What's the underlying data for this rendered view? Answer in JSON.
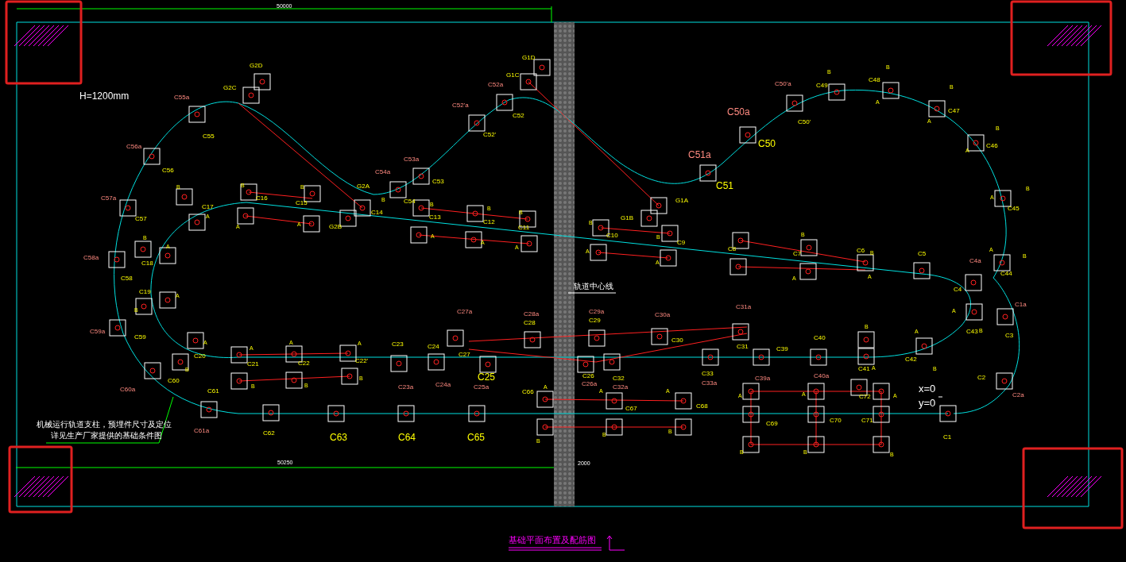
{
  "labels": [
    {
      "text": "50000",
      "kind": "dimension"
    },
    {
      "text": "H=1200mm",
      "kind": "height"
    },
    {
      "text": "G2D",
      "kind": "column"
    },
    {
      "text": "G2C",
      "kind": "column"
    },
    {
      "text": "C55a",
      "kind": "marker"
    },
    {
      "text": "C55",
      "kind": "column"
    },
    {
      "text": "C56a",
      "kind": "marker"
    },
    {
      "text": "C56",
      "kind": "column"
    },
    {
      "text": "C57a",
      "kind": "marker"
    },
    {
      "text": "C57",
      "kind": "column"
    },
    {
      "text": "C58a",
      "kind": "marker"
    },
    {
      "text": "C58",
      "kind": "column"
    },
    {
      "text": "B",
      "kind": "side"
    },
    {
      "text": "C17",
      "kind": "column"
    },
    {
      "text": "A",
      "kind": "side"
    },
    {
      "text": "B",
      "kind": "side"
    },
    {
      "text": "A",
      "kind": "side"
    },
    {
      "text": "C18",
      "kind": "column"
    },
    {
      "text": "B",
      "kind": "side"
    },
    {
      "text": "C16",
      "kind": "column"
    },
    {
      "text": "B",
      "kind": "side"
    },
    {
      "text": "C15",
      "kind": "column"
    },
    {
      "text": "A",
      "kind": "side"
    },
    {
      "text": "A",
      "kind": "side"
    },
    {
      "text": "G2A",
      "kind": "column"
    },
    {
      "text": "G2B",
      "kind": "column"
    },
    {
      "text": "C14",
      "kind": "column"
    },
    {
      "text": "C54a",
      "kind": "marker"
    },
    {
      "text": "B",
      "kind": "side"
    },
    {
      "text": "C53a",
      "kind": "marker"
    },
    {
      "text": "C54",
      "kind": "column"
    },
    {
      "text": "C53",
      "kind": "column"
    },
    {
      "text": "C52'a",
      "kind": "marker"
    },
    {
      "text": "C52'",
      "kind": "column"
    },
    {
      "text": "C52a",
      "kind": "marker"
    },
    {
      "text": "C52",
      "kind": "column"
    },
    {
      "text": "G1C",
      "kind": "column"
    },
    {
      "text": "G1D",
      "kind": "column"
    },
    {
      "text": "B",
      "kind": "side"
    },
    {
      "text": "C13",
      "kind": "column"
    },
    {
      "text": "A",
      "kind": "side"
    },
    {
      "text": "B",
      "kind": "side"
    },
    {
      "text": "C12",
      "kind": "column"
    },
    {
      "text": "A",
      "kind": "side"
    },
    {
      "text": "B",
      "kind": "side"
    },
    {
      "text": "C11",
      "kind": "column"
    },
    {
      "text": "A",
      "kind": "side"
    },
    {
      "text": "C51a",
      "kind": "marker_large"
    },
    {
      "text": "C51",
      "kind": "column_large"
    },
    {
      "text": "C50a",
      "kind": "marker_large"
    },
    {
      "text": "C50",
      "kind": "column_large"
    },
    {
      "text": "C50'a",
      "kind": "marker"
    },
    {
      "text": "C50'",
      "kind": "column"
    },
    {
      "text": "G1A",
      "kind": "column"
    },
    {
      "text": "G1B",
      "kind": "column"
    },
    {
      "text": "B",
      "kind": "side"
    },
    {
      "text": "C10",
      "kind": "column"
    },
    {
      "text": "A",
      "kind": "side"
    },
    {
      "text": "B",
      "kind": "side"
    },
    {
      "text": "C9",
      "kind": "column"
    },
    {
      "text": "A",
      "kind": "side"
    },
    {
      "text": "C8",
      "kind": "column"
    },
    {
      "text": "B",
      "kind": "side"
    },
    {
      "text": "C49",
      "kind": "column"
    },
    {
      "text": "B",
      "kind": "side"
    },
    {
      "text": "C48",
      "kind": "column"
    },
    {
      "text": "A",
      "kind": "side"
    },
    {
      "text": "B",
      "kind": "side"
    },
    {
      "text": "C47",
      "kind": "column"
    },
    {
      "text": "A",
      "kind": "side"
    },
    {
      "text": "B",
      "kind": "side"
    },
    {
      "text": "C46",
      "kind": "column"
    },
    {
      "text": "A",
      "kind": "side"
    },
    {
      "text": "B",
      "kind": "side"
    },
    {
      "text": "A",
      "kind": "side"
    },
    {
      "text": "C45",
      "kind": "column"
    },
    {
      "text": "B",
      "kind": "side"
    },
    {
      "text": "C7",
      "kind": "column"
    },
    {
      "text": "C6",
      "kind": "column"
    },
    {
      "text": "B",
      "kind": "side"
    },
    {
      "text": "C5",
      "kind": "column"
    },
    {
      "text": "C4a",
      "kind": "marker"
    },
    {
      "text": "A",
      "kind": "side"
    },
    {
      "text": "B",
      "kind": "side"
    },
    {
      "text": "C44",
      "kind": "column"
    },
    {
      "text": "A",
      "kind": "side"
    },
    {
      "text": "A",
      "kind": "side"
    },
    {
      "text": "C19",
      "kind": "column"
    },
    {
      "text": "A",
      "kind": "side"
    },
    {
      "text": "B",
      "kind": "side"
    },
    {
      "text": "C59a",
      "kind": "marker"
    },
    {
      "text": "C59",
      "kind": "column"
    },
    {
      "text": "A",
      "kind": "side"
    },
    {
      "text": "C20",
      "kind": "column"
    },
    {
      "text": "B",
      "kind": "side"
    },
    {
      "text": "C60",
      "kind": "column"
    },
    {
      "text": "C60a",
      "kind": "marker"
    },
    {
      "text": "A",
      "kind": "side"
    },
    {
      "text": "C21",
      "kind": "column"
    },
    {
      "text": "A",
      "kind": "side"
    },
    {
      "text": "C22",
      "kind": "column"
    },
    {
      "text": "A",
      "kind": "side"
    },
    {
      "text": "C22'",
      "kind": "column"
    },
    {
      "text": "B",
      "kind": "side"
    },
    {
      "text": "B",
      "kind": "side"
    },
    {
      "text": "B",
      "kind": "side"
    },
    {
      "text": "C61",
      "kind": "column"
    },
    {
      "text": "C61a",
      "kind": "marker"
    },
    {
      "text": "C62",
      "kind": "column"
    },
    {
      "text": "C63",
      "kind": "column_large"
    },
    {
      "text": "机械运行轨道支柱，预埋件尺寸及定位",
      "kind": "note"
    },
    {
      "text": "详见生产厂家提供的基础条件图",
      "kind": "note"
    },
    {
      "text": "50250",
      "kind": "dimension"
    },
    {
      "text": "轨道中心线",
      "kind": "callout"
    },
    {
      "text": "C27a",
      "kind": "marker"
    },
    {
      "text": "C28a",
      "kind": "marker"
    },
    {
      "text": "C28",
      "kind": "column"
    },
    {
      "text": "C29a",
      "kind": "marker"
    },
    {
      "text": "C29",
      "kind": "column"
    },
    {
      "text": "C30a",
      "kind": "marker"
    },
    {
      "text": "C31a",
      "kind": "marker"
    },
    {
      "text": "C23",
      "kind": "column"
    },
    {
      "text": "C24",
      "kind": "column"
    },
    {
      "text": "C27",
      "kind": "column"
    },
    {
      "text": "C30",
      "kind": "column"
    },
    {
      "text": "C31",
      "kind": "column"
    },
    {
      "text": "C25",
      "kind": "column_large"
    },
    {
      "text": "C26",
      "kind": "column"
    },
    {
      "text": "C32",
      "kind": "column"
    },
    {
      "text": "C33",
      "kind": "column"
    },
    {
      "text": "C23a",
      "kind": "marker"
    },
    {
      "text": "C24a",
      "kind": "marker"
    },
    {
      "text": "C25a",
      "kind": "marker"
    },
    {
      "text": "C26a",
      "kind": "marker"
    },
    {
      "text": "C32a",
      "kind": "marker"
    },
    {
      "text": "C33a",
      "kind": "marker"
    },
    {
      "text": "C66",
      "kind": "column"
    },
    {
      "text": "A",
      "kind": "side"
    },
    {
      "text": "A",
      "kind": "side"
    },
    {
      "text": "A",
      "kind": "side"
    },
    {
      "text": "C67",
      "kind": "column"
    },
    {
      "text": "C68",
      "kind": "column"
    },
    {
      "text": "B",
      "kind": "side"
    },
    {
      "text": "B",
      "kind": "side"
    },
    {
      "text": "B",
      "kind": "side"
    },
    {
      "text": "C64",
      "kind": "column_large"
    },
    {
      "text": "C65",
      "kind": "column_large"
    },
    {
      "text": "2000",
      "kind": "dimension"
    },
    {
      "text": "基础平面布置及配筋图",
      "kind": "title"
    },
    {
      "text": "C39",
      "kind": "column"
    },
    {
      "text": "C40",
      "kind": "column"
    },
    {
      "text": "B",
      "kind": "side"
    },
    {
      "text": "C39a",
      "kind": "marker"
    },
    {
      "text": "C40a",
      "kind": "marker"
    },
    {
      "text": "C41",
      "kind": "column"
    },
    {
      "text": "A",
      "kind": "side"
    },
    {
      "text": "A",
      "kind": "side"
    },
    {
      "text": "C42",
      "kind": "column"
    },
    {
      "text": "B",
      "kind": "side"
    },
    {
      "text": "A",
      "kind": "side"
    },
    {
      "text": "C43",
      "kind": "column"
    },
    {
      "text": "B",
      "kind": "side"
    },
    {
      "text": "C1a",
      "kind": "marker"
    },
    {
      "text": "C3",
      "kind": "column"
    },
    {
      "text": "C2",
      "kind": "column"
    },
    {
      "text": "C2a",
      "kind": "marker"
    },
    {
      "text": "C4",
      "kind": "column"
    },
    {
      "text": "A",
      "kind": "side"
    },
    {
      "text": "A",
      "kind": "side"
    },
    {
      "text": "C72",
      "kind": "column"
    },
    {
      "text": "A",
      "kind": "side"
    },
    {
      "text": "C69",
      "kind": "column"
    },
    {
      "text": "C70",
      "kind": "column"
    },
    {
      "text": "C71",
      "kind": "column"
    },
    {
      "text": "C1",
      "kind": "column"
    },
    {
      "text": "B",
      "kind": "side"
    },
    {
      "text": "B",
      "kind": "side"
    },
    {
      "text": "B",
      "kind": "side"
    },
    {
      "text": "x=0",
      "kind": "origin"
    },
    {
      "text": "y=0",
      "kind": "origin"
    }
  ]
}
